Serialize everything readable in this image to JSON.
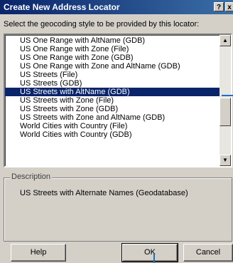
{
  "window": {
    "title": "Create New Address Locator",
    "help_glyph": "?",
    "close_glyph": "x"
  },
  "prompt": "Select the geocoding style to be provided by this locator:",
  "styles": {
    "items": [
      "US One Range with AltName (GDB)",
      "US One Range with Zone (File)",
      "US One Range with Zone (GDB)",
      "US One Range with Zone and AltName (GDB)",
      "US Streets (File)",
      "US Streets (GDB)",
      "US Streets with AltName (GDB)",
      "US Streets with Zone (File)",
      "US Streets with Zone (GDB)",
      "US Streets with Zone and AltName (GDB)",
      "World Cities with Country (File)",
      "World Cities with Country (GDB)"
    ],
    "selected": "US Streets with AltName (GDB)"
  },
  "description": {
    "label": "Description",
    "text": "US Streets with Alternate Names (Geodatabase)"
  },
  "buttons": {
    "help": "Help",
    "ok": "OK",
    "cancel": "Cancel"
  },
  "colors": {
    "selection": "#0a246a",
    "titlebar": "#0a246a",
    "callout": "#1f6fbf"
  },
  "icons": {
    "scroll_up": "up-arrow-icon",
    "scroll_down": "down-arrow-icon"
  }
}
